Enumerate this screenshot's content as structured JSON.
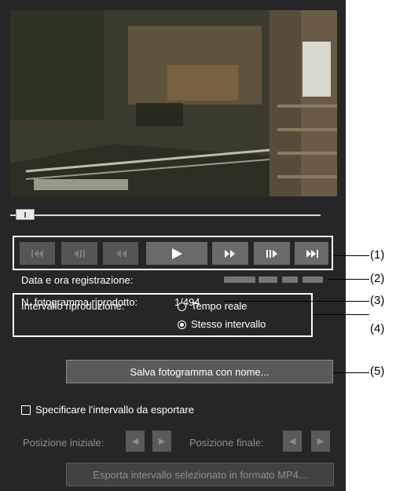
{
  "transport": {
    "buttons": [
      {
        "name": "skip-to-start",
        "enabled": false
      },
      {
        "name": "frame-back",
        "enabled": false
      },
      {
        "name": "rewind",
        "enabled": false
      },
      {
        "name": "play",
        "enabled": true
      },
      {
        "name": "fast-forward",
        "enabled": true
      },
      {
        "name": "frame-forward",
        "enabled": true
      },
      {
        "name": "skip-to-end",
        "enabled": true
      }
    ]
  },
  "seek": {
    "position_fraction": 0.02
  },
  "info": {
    "recording_label": "Data e ora registrazione:",
    "frame_label": "N. fotogramma riprodotto:",
    "frame_value": "1/494"
  },
  "interval": {
    "label": "Intervallo riproduzione:",
    "options": [
      {
        "label": "Tempo reale",
        "checked": false
      },
      {
        "label": "Stesso intervallo",
        "checked": true
      }
    ]
  },
  "save_button": "Salva fotogramma con nome...",
  "export": {
    "checkbox_label": "Specificare l'intervallo da esportare",
    "checked": false,
    "start_label": "Posizione iniziale:",
    "end_label": "Posizione finale:",
    "export_button": "Esporta intervallo selezionato in formato MP4..."
  },
  "callouts": [
    "(1)",
    "(2)",
    "(3)",
    "(4)",
    "(5)"
  ],
  "colors": {
    "panel": "#262626",
    "button": "#5a5a5a",
    "disabled_text": "#8f8f8f"
  }
}
